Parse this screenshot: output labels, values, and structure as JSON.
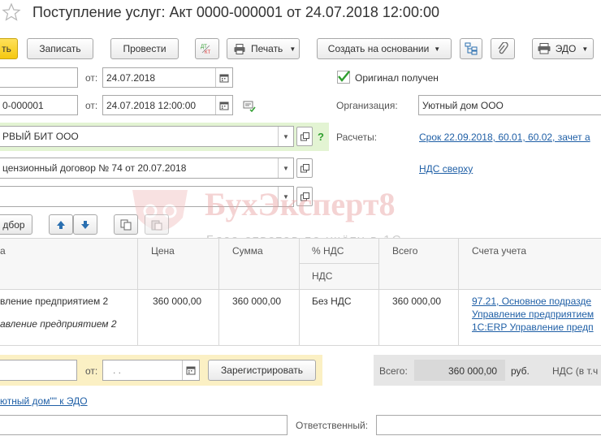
{
  "header": {
    "title": "Поступление услуг: Акт 0000-000001 от 24.07.2018 12:00:00"
  },
  "toolbar": {
    "post_close_label": "ть",
    "save_label": "Записать",
    "post_label": "Провести",
    "dtkt_label": "Дт Кт",
    "print_label": "Печать",
    "create_based_label": "Создать на основании",
    "edo_label": "ЭДО"
  },
  "form": {
    "number_value": "",
    "date_label": "от:",
    "date_value": "24.07.2018",
    "original_received_label": "Оригинал получен",
    "original_received_checked": true,
    "incoming_number_value": "0-000001",
    "incoming_date_label": "от:",
    "incoming_date_value": "24.07.2018 12:00:00",
    "organization_label": "Организация:",
    "organization_value": "Уютный дом ООО",
    "counterparty_value": "РВЫЙ БИТ ООО",
    "settlements_label": "Расчеты:",
    "settlements_link": "Срок 22.09.2018, 60.01, 60.02, зачет а",
    "contract_value": "цензионный договор № 74 от 20.07.2018",
    "vat_link": "НДС сверху",
    "help_mark": "?"
  },
  "table_toolbar": {
    "selection_label": "дбор"
  },
  "watermark": {
    "brand": "БухЭксперт8",
    "subtitle": "База ответов по учёту в 1С"
  },
  "table": {
    "columns": {
      "name": "а",
      "price": "Цена",
      "sum": "Сумма",
      "vat_rate": "% НДС",
      "vat": "НДС",
      "total": "Всего",
      "accounts": "Счета учета"
    },
    "rows": [
      {
        "name": "вление предприятием 2",
        "name_content": "авление предприятием 2",
        "price": "360 000,00",
        "sum": "360 000,00",
        "vat_rate": "Без НДС",
        "total": "360 000,00",
        "account_1": "97.21, Основное подразде",
        "account_2": "Управление предприятием",
        "account_3": "1С:ERP Управление предп"
      }
    ]
  },
  "footer": {
    "invoice_date_label": "от:",
    "invoice_date_value": ". .",
    "register_label": "Зарегистрировать",
    "total_label": "Всего:",
    "total_value": "360 000,00",
    "currency": "руб.",
    "vat_incl_label": "НДС (в т.ч",
    "edo_link": "ютный дом\"\" к ЭДО",
    "responsible_label": "Ответственный:"
  },
  "colors": {
    "accent_yellow": "#f5c80f",
    "link": "#1f5fa6",
    "highlight_green": "#e3f4d3",
    "highlight_yellow": "#fbf0c4",
    "check_green": "#2f9e2f",
    "watermark_red": "#e8a0a0"
  }
}
